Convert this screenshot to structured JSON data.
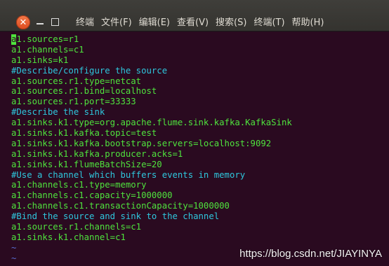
{
  "window": {
    "close_glyph": "✕",
    "menu": [
      "终端",
      "文件(F)",
      "编辑(E)",
      "查看(V)",
      "搜索(S)",
      "终端(T)",
      "帮助(H)"
    ]
  },
  "terminal": {
    "cursor_char": "a",
    "first_line_rest": "1.sources=r1",
    "lines": [
      {
        "type": "code",
        "text": "a1.channels=c1"
      },
      {
        "type": "code",
        "text": "a1.sinks=k1"
      },
      {
        "type": "comment",
        "text": "#Describe/configure the source"
      },
      {
        "type": "code",
        "text": "a1.sources.r1.type=netcat"
      },
      {
        "type": "code",
        "text": "a1.sources.r1.bind=localhost"
      },
      {
        "type": "code",
        "text": "a1.sources.r1.port=33333"
      },
      {
        "type": "comment",
        "text": "#Describe the sink"
      },
      {
        "type": "code",
        "text": "a1.sinks.k1.type=org.apache.flume.sink.kafka.KafkaSink"
      },
      {
        "type": "code",
        "text": "a1.sinks.k1.kafka.topic=test"
      },
      {
        "type": "code",
        "text": "a1.sinks.k1.kafka.bootstrap.servers=localhost:9092"
      },
      {
        "type": "code",
        "text": "a1.sinks.k1.kafka.producer.acks=1"
      },
      {
        "type": "code",
        "text": "a1.sinks.k1.flumeBatchSize=20"
      },
      {
        "type": "comment",
        "text": "#Use a channel which buffers events in memory"
      },
      {
        "type": "code",
        "text": "a1.channels.c1.type=memory"
      },
      {
        "type": "code",
        "text": "a1.channels.c1.capacity=1000000"
      },
      {
        "type": "code",
        "text": "a1.channels.c1.transactionCapacity=1000000"
      },
      {
        "type": "comment",
        "text": "#Bind the source and sink to the channel"
      },
      {
        "type": "code",
        "text": "a1.sources.r1.channels=c1"
      },
      {
        "type": "code",
        "text": "a1.sinks.k1.channel=c1"
      },
      {
        "type": "tilde",
        "text": "~"
      },
      {
        "type": "tilde",
        "text": "~"
      }
    ]
  },
  "watermark": "https://blog.csdn.net/JIAYINYA",
  "colors": {
    "code": "#4fe33d",
    "comment": "#2ec7dd",
    "tilde": "#5a6fd6",
    "terminal_bg": "#2a0a20",
    "close_button": "#e8562a"
  }
}
